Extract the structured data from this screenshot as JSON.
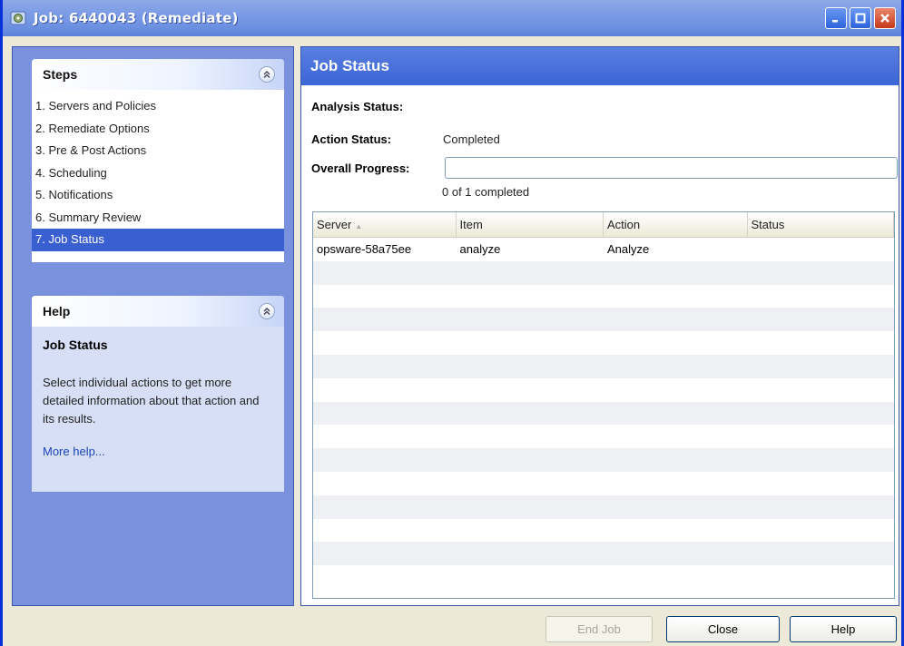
{
  "window": {
    "title": "Job: 6440043 (Remediate)",
    "icon": "job-gear-icon",
    "controls": [
      "minimize",
      "maximize",
      "close"
    ]
  },
  "steps": {
    "title": "Steps",
    "items": [
      {
        "label": "1. Servers and Policies"
      },
      {
        "label": "2. Remediate Options"
      },
      {
        "label": "3. Pre & Post Actions"
      },
      {
        "label": "4. Scheduling"
      },
      {
        "label": "5. Notifications"
      },
      {
        "label": "6. Summary Review"
      },
      {
        "label": "7. Job Status",
        "active": true
      }
    ]
  },
  "help": {
    "title": "Help",
    "heading": "Job Status",
    "text": "Select individual actions to get more detailed information about that action and its results.",
    "link": "More help..."
  },
  "job_status": {
    "title": "Job Status",
    "analysis_label": "Analysis Status:",
    "analysis_value": "",
    "action_label": "Action Status:",
    "action_value": "Completed",
    "progress_label": "Overall Progress:",
    "progress_fraction": 0,
    "progress_text": "0 of 1 completed"
  },
  "table": {
    "columns": [
      "Server",
      "Item",
      "Action",
      "Status"
    ],
    "rows": [
      {
        "server": "opsware-58a75ee",
        "item": "analyze",
        "action": "Analyze",
        "status": ""
      }
    ]
  },
  "buttons": {
    "end_job": "End Job",
    "close": "Close",
    "help": "Help"
  },
  "colors": {
    "title_bar": "#6f92e2",
    "panel_blue": "#7a92de",
    "selected_step": "#3a5fd0",
    "header_blue": "#3c65d6"
  }
}
